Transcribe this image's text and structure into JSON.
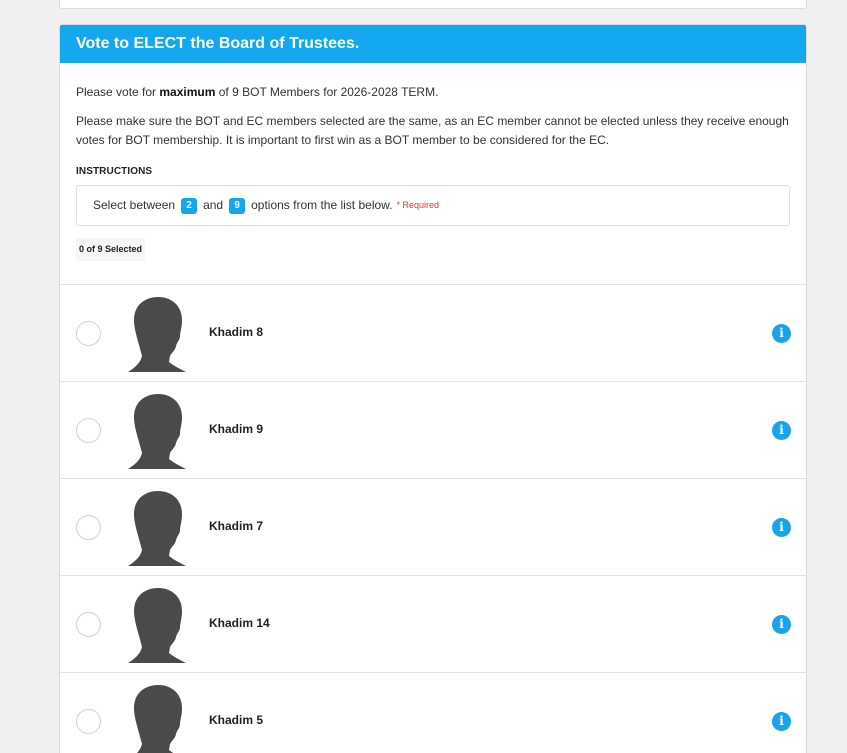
{
  "form": {
    "title": "Vote to ELECT the Board of Trustees.",
    "line1_pre": "Please vote for ",
    "line1_bold": "maximum",
    "line1_post": " of 9 BOT Members for 2026-2028 TERM.",
    "line2": "Please make sure the BOT and EC members selected are the same, as an EC member cannot be elected unless they receive enough votes for BOT membership. It is important to first win as a BOT member to be considered for the EC.",
    "instructions_title": "INSTRUCTIONS",
    "instr_select": "Select between",
    "instr_min": "2",
    "instr_and": "and",
    "instr_max": "9",
    "instr_tail": "options from the list below.",
    "required": "* Required",
    "selected_count": "0 of 9 Selected"
  },
  "candidates": [
    {
      "name": "Khadim 8",
      "info_icon": "info-icon"
    },
    {
      "name": "Khadim 9",
      "info_icon": "info-icon"
    },
    {
      "name": "Khadim 7",
      "info_icon": "info-icon"
    },
    {
      "name": "Khadim 14",
      "info_icon": "info-icon"
    },
    {
      "name": "Khadim 5",
      "info_icon": "info-icon"
    }
  ],
  "colors": {
    "accent": "#12a7ee",
    "required": "#d9342b",
    "avatar": "#4a4a4a"
  }
}
